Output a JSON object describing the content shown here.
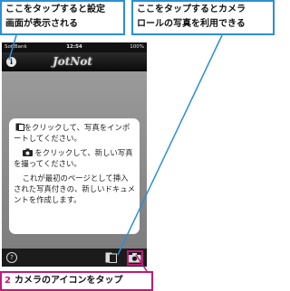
{
  "callouts": {
    "left": "ここをタップすると設定\n画面が表示される",
    "right": "ここをタップするとカメラ\nロールの写真を利用できる"
  },
  "statusbar": {
    "carrier": "SoftBank",
    "time": "12:54",
    "battery": "100%"
  },
  "navbar": {
    "info_label": "i",
    "logo": "JotNot"
  },
  "message": {
    "line1": "をクリックして、写真をインポートしてください。",
    "line2": "をクリックして、新しい写真を撮ってください。",
    "line3": "これが最初のページとして挿入された写真付きの、新しいドキュメントを作成します。"
  },
  "toolbar": {
    "help_label": "?"
  },
  "step": {
    "number": "2",
    "text": "カメラのアイコンをタップ"
  },
  "colors": {
    "callout_border": "#2b8fd6",
    "step_border": "#c2187a"
  }
}
